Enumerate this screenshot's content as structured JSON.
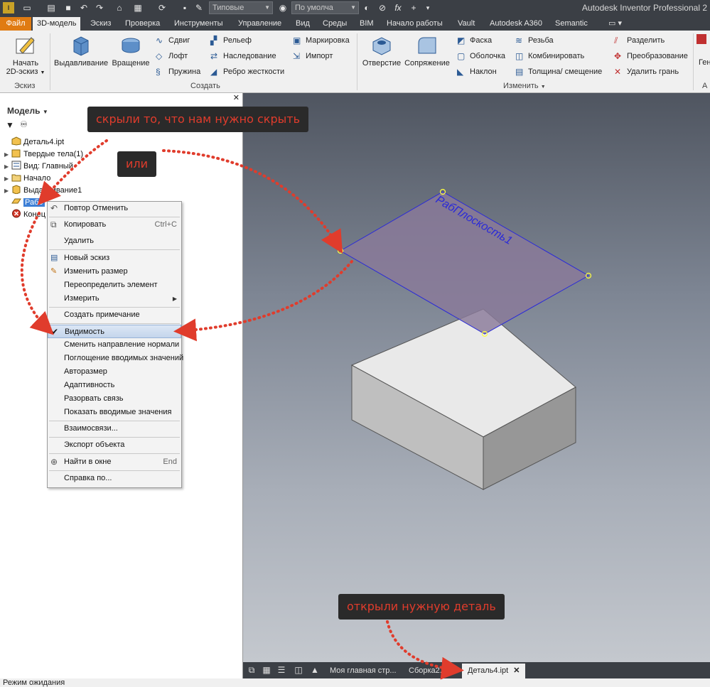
{
  "app": {
    "title": "Autodesk Inventor Professional 2",
    "appearance_select": "Типовые",
    "material_select": "По умолча",
    "fx": "fx"
  },
  "tabs": [
    "Файл",
    "3D-модель",
    "Эскиз",
    "Проверка",
    "Инструменты",
    "Управление",
    "Вид",
    "Среды",
    "BIM",
    "Начало работы",
    "Vault",
    "Autodesk A360",
    "Semantic"
  ],
  "ribbon": {
    "sketch": {
      "start_label_1": "Начать",
      "start_label_2": "2D-эскиз",
      "panel": "Эскиз"
    },
    "create": {
      "extrude": "Выдавливание",
      "revolve": "Вращение",
      "sweep": "Сдвиг",
      "loft": "Лофт",
      "coil": "Пружина",
      "emboss": "Рельеф",
      "derive": "Наследование",
      "rib": "Ребро жесткости",
      "decal": "Маркировка",
      "import": "Импорт",
      "panel": "Создать"
    },
    "modify": {
      "hole": "Отверстие",
      "fillet": "Сопряжение",
      "chamfer": "Фаска",
      "shell": "Оболочка",
      "draft": "Наклон",
      "thread": "Резьба",
      "combine": "Комбинировать",
      "thicken": "Толщина/ смещение",
      "split": "Разделить",
      "direct": "Преобразование",
      "delete_face": "Удалить грань",
      "panel": "Изменить"
    },
    "extra_1": "Гене",
    "extra_2": "А"
  },
  "browser": {
    "title": "Модель",
    "items": [
      {
        "label": "Деталь4.ipt"
      },
      {
        "label": "Твердые тела(1)"
      },
      {
        "label": "Вид: Главный"
      },
      {
        "label": "Начало"
      },
      {
        "label": "Выдавливание1"
      },
      {
        "label": "Рабо"
      },
      {
        "label": "Конец"
      }
    ]
  },
  "context_menu": {
    "items": [
      {
        "label": "Повтор Отменить",
        "shortcut": ""
      },
      {
        "label": "Копировать",
        "shortcut": "Ctrl+C"
      },
      {
        "label": "Удалить",
        "shortcut": ""
      },
      {
        "label": "Новый эскиз",
        "shortcut": ""
      },
      {
        "label": "Изменить размер",
        "shortcut": ""
      },
      {
        "label": "Переопределить элемент",
        "shortcut": ""
      },
      {
        "label": "Измерить",
        "shortcut": ""
      },
      {
        "label": "Создать примечание",
        "shortcut": ""
      },
      {
        "label": "Видимость",
        "shortcut": ""
      },
      {
        "label": "Сменить направление нормали",
        "shortcut": ""
      },
      {
        "label": "Поглощение вводимых значений",
        "shortcut": ""
      },
      {
        "label": "Авторазмер",
        "shortcut": ""
      },
      {
        "label": "Адаптивность",
        "shortcut": ""
      },
      {
        "label": "Разорвать связь",
        "shortcut": ""
      },
      {
        "label": "Показать вводимые значения",
        "shortcut": ""
      },
      {
        "label": "Взаимосвязи...",
        "shortcut": ""
      },
      {
        "label": "Экспорт объекта",
        "shortcut": ""
      },
      {
        "label": "Найти в окне",
        "shortcut": "End"
      },
      {
        "label": "Справка по...",
        "shortcut": ""
      }
    ]
  },
  "viewport": {
    "plane_label": "РабПлоскость1"
  },
  "callouts": {
    "hidden": "скрыли то, что нам нужно скрыть",
    "or": "или",
    "opened": "открыли нужную деталь"
  },
  "doc_tabs": [
    "Моя главная стр...",
    "Сборка2.iam",
    "Деталь4.ipt"
  ],
  "status": {
    "text": "Режим ожидания"
  },
  "colors": {
    "accent": "#e07b12",
    "annotation": "#e03c2c",
    "plane": "#8a7a9a",
    "plane_edge": "#2a2ad8"
  }
}
